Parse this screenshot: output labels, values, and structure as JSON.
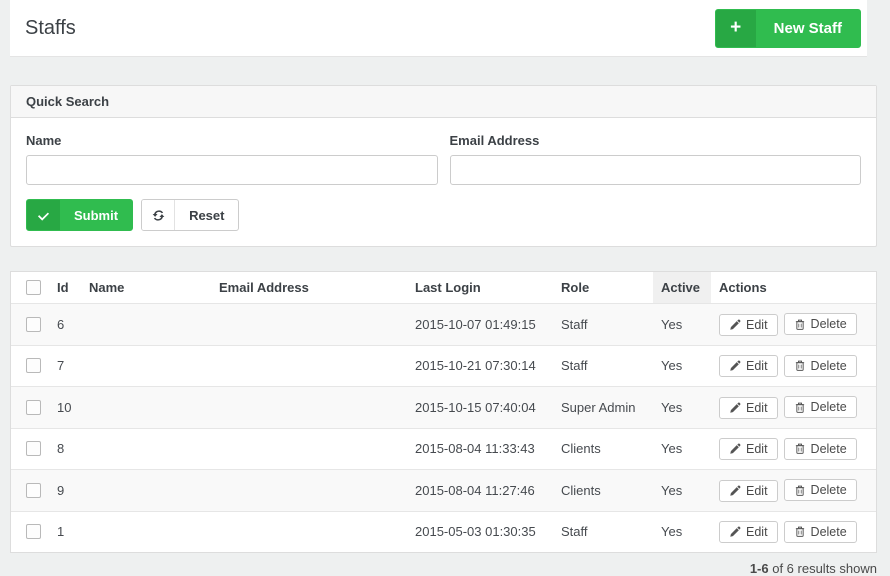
{
  "header": {
    "title": "Staffs",
    "new_staff_label": "New Staff",
    "plus_icon": "+"
  },
  "colors": {
    "accent_green": "#30bc4f",
    "accent_green_dark": "#28a844",
    "page_bg": "#eef0f0",
    "panel_header_bg": "#f7f7f7",
    "stripe_bg": "#f9f9f9",
    "sorted_header_bg": "#f0f0f0",
    "border": "#dddddd"
  },
  "search_panel": {
    "title": "Quick Search",
    "fields": [
      {
        "label": "Name",
        "value": "",
        "placeholder": ""
      },
      {
        "label": "Email Address",
        "value": "",
        "placeholder": ""
      }
    ],
    "submit_label": "Submit",
    "reset_label": "Reset"
  },
  "table": {
    "columns": [
      "Id",
      "Name",
      "Email Address",
      "Last Login",
      "Role",
      "Active",
      "Actions"
    ],
    "sorted_column": "Active",
    "edit_label": "Edit",
    "delete_label": "Delete",
    "rows": [
      {
        "id": "6",
        "name": "",
        "email": "",
        "last_login": "2015-10-07 01:49:15",
        "role": "Staff",
        "active": "Yes"
      },
      {
        "id": "7",
        "name": "",
        "email": "",
        "last_login": "2015-10-21 07:30:14",
        "role": "Staff",
        "active": "Yes"
      },
      {
        "id": "10",
        "name": "",
        "email": "",
        "last_login": "2015-10-15 07:40:04",
        "role": "Super Admin",
        "active": "Yes"
      },
      {
        "id": "8",
        "name": "",
        "email": "",
        "last_login": "2015-08-04 11:33:43",
        "role": "Clients",
        "active": "Yes"
      },
      {
        "id": "9",
        "name": "",
        "email": "",
        "last_login": "2015-08-04 11:27:46",
        "role": "Clients",
        "active": "Yes"
      },
      {
        "id": "1",
        "name": "",
        "email": "",
        "last_login": "2015-05-03 01:30:35",
        "role": "Staff",
        "active": "Yes"
      }
    ]
  },
  "footer": {
    "summary_bold": "1-6",
    "summary_rest": " of 6 results shown"
  }
}
